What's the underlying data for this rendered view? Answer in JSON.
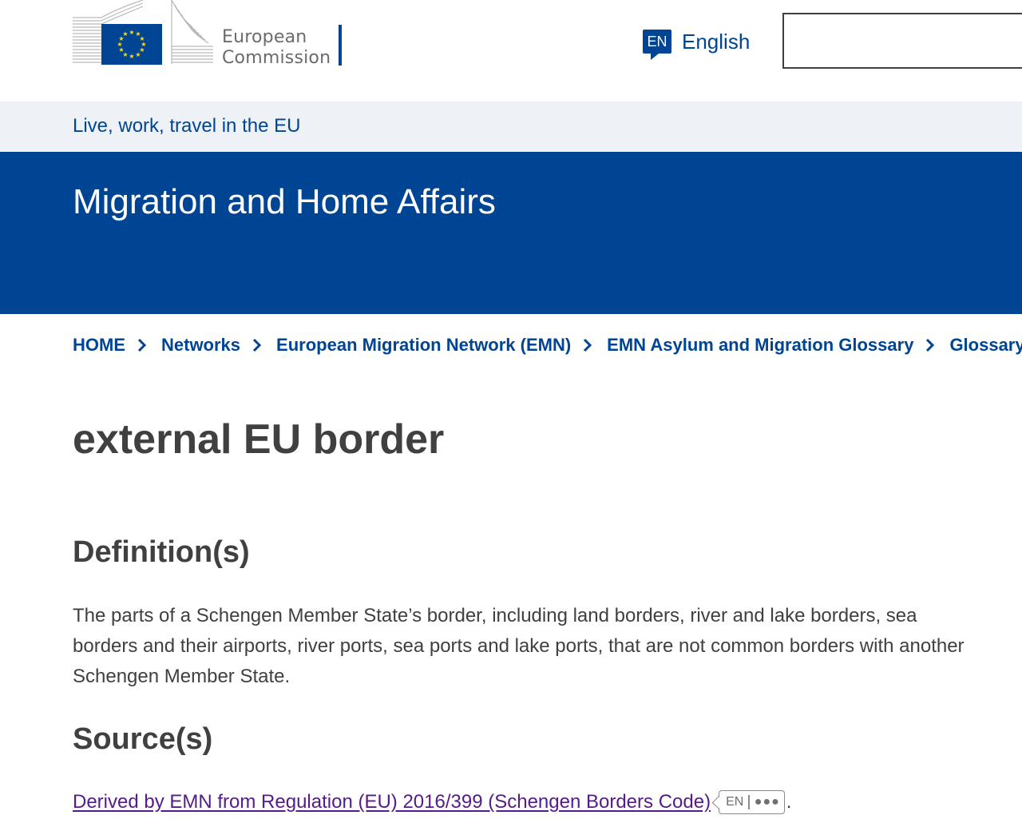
{
  "header": {
    "logo_text_line1": "European",
    "logo_text_line2": "Commission",
    "language_code": "EN",
    "language_label": "English",
    "search_value": ""
  },
  "tagline": "Live, work, travel in the EU",
  "site_title": "Migration and Home Affairs",
  "breadcrumb": [
    "HOME",
    "Networks",
    "European Migration Network (EMN)",
    "EMN Asylum and Migration Glossary",
    "Glossary"
  ],
  "page_title": "external EU border",
  "definitions_heading": "Definition(s)",
  "definition_text": "The parts of a Schengen Member State’s border, including land borders, river and lake borders, sea borders and their airports, river ports, sea ports and lake ports, that are not common borders with another Schengen Member State.",
  "sources_heading": "Source(s)",
  "source": {
    "link_text": "Derived by EMN from Regulation (EU) 2016/399 (Schengen Borders Code)",
    "badge_lang": "EN",
    "badge_more": "●●●",
    "trailing": "."
  },
  "colors": {
    "brand_blue": "#004494",
    "tagline_bg": "#eef2f6",
    "eu_flag_yellow": "#ffde00",
    "visited_link": "#551a8b",
    "text": "#404040"
  }
}
